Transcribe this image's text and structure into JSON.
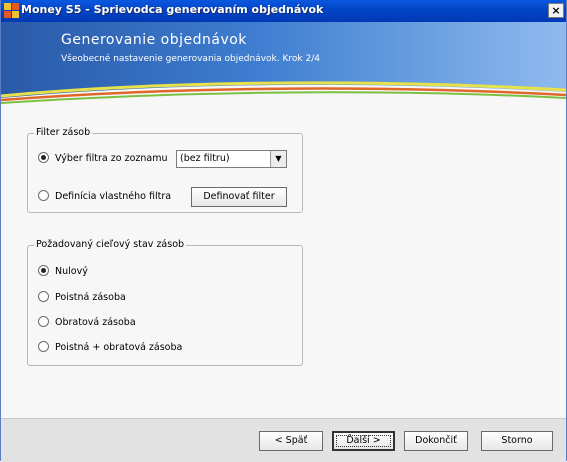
{
  "window": {
    "title": "Money S5 - Sprievodca generovaním objednávok",
    "close_glyph": "×"
  },
  "banner": {
    "title": "Generovanie objednávok",
    "subtitle": "Všeobecné nastavenie generovania objednávok. Krok 2/4"
  },
  "filter_group": {
    "legend": "Filter zásob",
    "option_list": {
      "label": "Výber filtra zo zoznamu",
      "checked": true
    },
    "select": {
      "value": "(bez filtru)",
      "arrow_glyph": "▼"
    },
    "option_custom": {
      "label": "Definícia vlastného filtra",
      "checked": false
    },
    "define_button": "Definovať filter"
  },
  "target_group": {
    "legend": "Požadovaný cieľový stav zásob",
    "options": [
      {
        "label": "Nulový",
        "checked": true
      },
      {
        "label": "Poistná zásoba",
        "checked": false
      },
      {
        "label": "Obratová zásoba",
        "checked": false
      },
      {
        "label": "Poistná + obratová zásoba",
        "checked": false
      }
    ]
  },
  "footer": {
    "back_label": "< Späť",
    "next_label": "Ďalší >",
    "finish_label": "Dokončiť",
    "cancel_label": "Storno"
  }
}
